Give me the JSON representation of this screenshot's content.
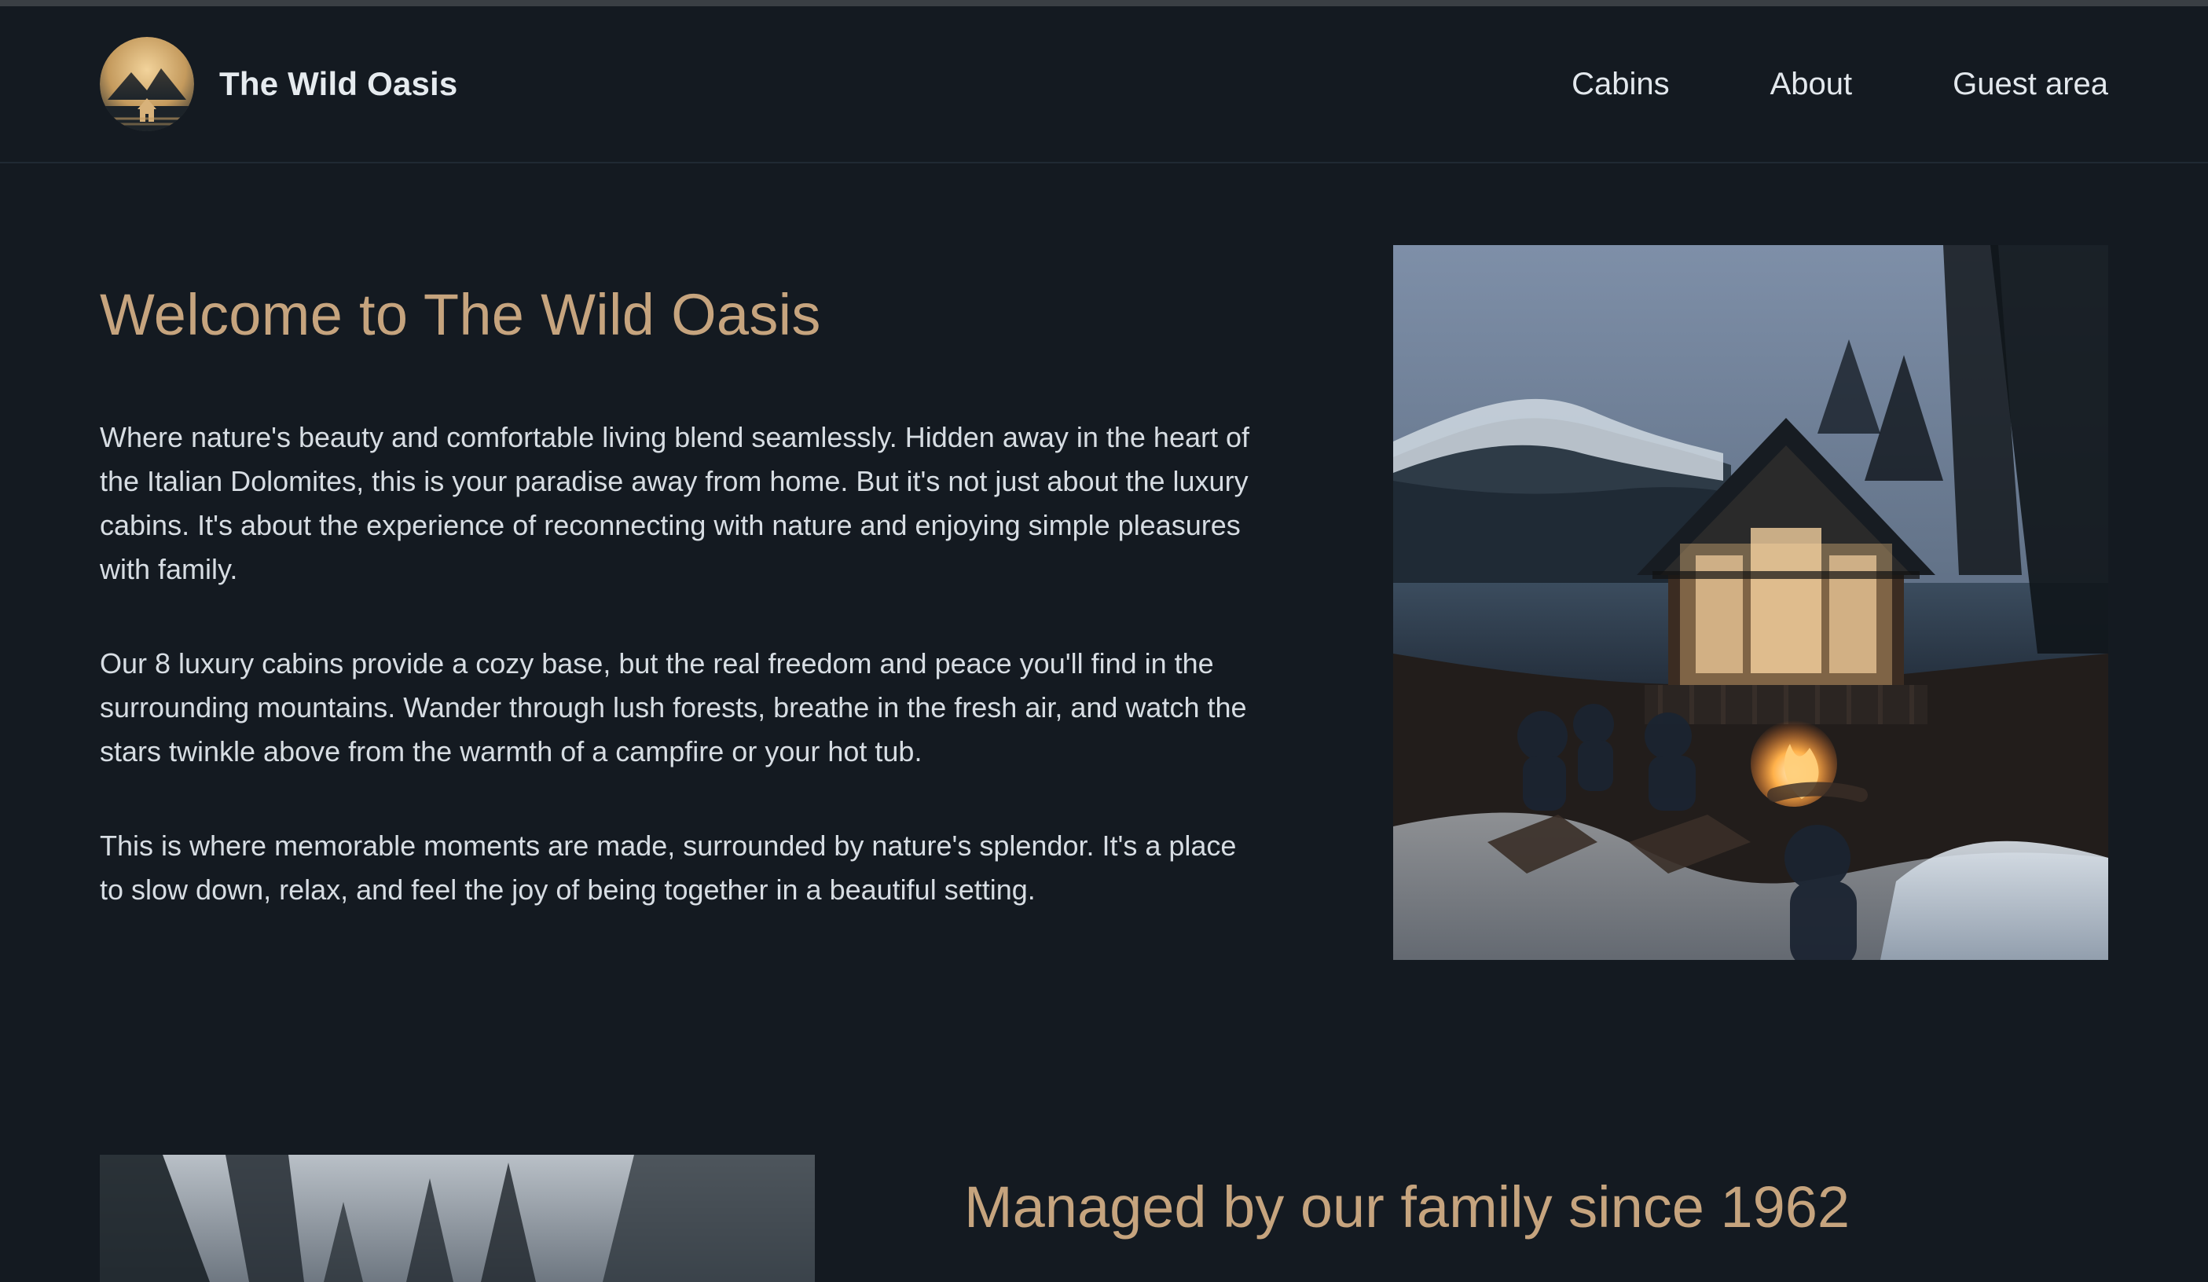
{
  "header": {
    "brand": "The Wild Oasis",
    "nav": [
      {
        "label": "Cabins"
      },
      {
        "label": "About"
      },
      {
        "label": "Guest area"
      }
    ]
  },
  "hero": {
    "title": "Welcome to The Wild Oasis",
    "paragraphs": [
      "Where nature's beauty and comfortable living blend seamlessly. Hidden away in the heart of the Italian Dolomites, this is your paradise away from home. But it's not just about the luxury cabins. It's about the experience of reconnecting with nature and enjoying simple pleasures with family.",
      "Our 8 luxury cabins provide a cozy base, but the real freedom and peace you'll find in the surrounding mountains. Wander through lush forests, breathe in the fresh air, and watch the stars twinkle above from the warmth of a campfire or your hot tub.",
      "This is where memorable moments are made, surrounded by nature's splendor. It's a place to slow down, relax, and feel the joy of being together in a beautiful setting."
    ]
  },
  "section2": {
    "title": "Managed by our family since 1962"
  },
  "colors": {
    "background": "#141a21",
    "accent": "#c6a47e",
    "text": "#d7dde3"
  }
}
